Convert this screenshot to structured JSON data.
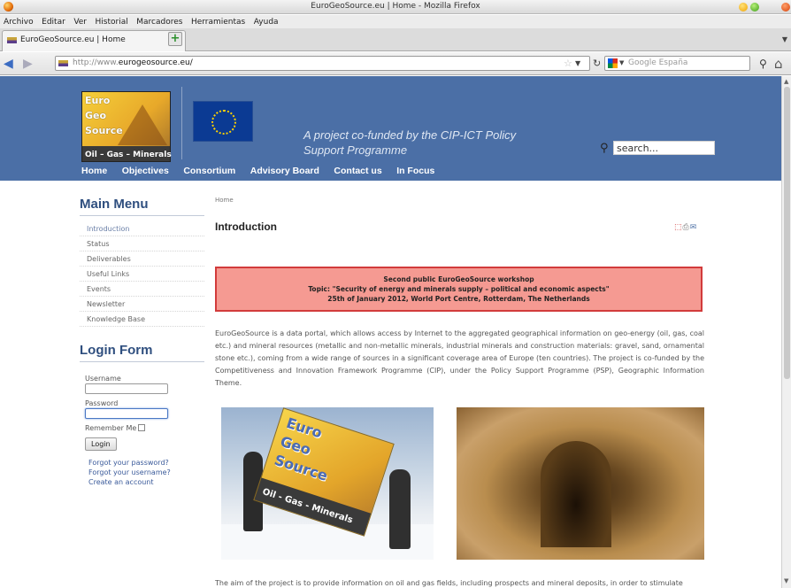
{
  "window": {
    "title": "EuroGeoSource.eu | Home - Mozilla Firefox"
  },
  "menubar": [
    "Archivo",
    "Editar",
    "Ver",
    "Historial",
    "Marcadores",
    "Herramientas",
    "Ayuda"
  ],
  "tab": {
    "title": "EuroGeoSource.eu | Home",
    "close": "×"
  },
  "navbar": {
    "url_prefix": "http://www.",
    "url_domain": "eurogeosource.eu/",
    "search_placeholder": "Google España"
  },
  "site": {
    "logo": {
      "line1": "Euro",
      "line2": "Geo",
      "line3": "Source",
      "tagline": "Oil – Gas – Minerals"
    },
    "slogan": "A project co-funded by the CIP-ICT Policy Support Programme",
    "search_value": "search...",
    "nav": [
      "Home",
      "Objectives",
      "Consortium",
      "Advisory Board",
      "Contact us",
      "In Focus"
    ]
  },
  "sidebar": {
    "main_menu_title": "Main Menu",
    "menu_items": [
      "Introduction",
      "Status",
      "Deliverables",
      "Useful Links",
      "Events",
      "Newsletter",
      "Knowledge Base"
    ],
    "login_title": "Login Form",
    "username_label": "Username",
    "password_label": "Password",
    "remember_label": "Remember Me",
    "login_button": "Login",
    "links": [
      "Forgot your password?",
      "Forgot your username?",
      "Create an account"
    ]
  },
  "content": {
    "breadcrumb": "Home",
    "title": "Introduction",
    "notice": {
      "line1": "Second public EuroGeoSource workshop",
      "line2": "Topic: \"Security of energy and minerals supply – political and economic aspects\"",
      "line3": "25th of January 2012, World Port Centre, Rotterdam, The Netherlands"
    },
    "intro": "EuroGeoSource is a data portal, which allows access by Internet to the aggregated geographical information on geo-energy (oil, gas, coal etc.) and mineral resources (metallic and non-metallic minerals, industrial minerals and construction materials: gravel, sand, ornamental stone etc.), coming from a wide range of sources in a significant coverage area of Europe (ten countries). The project is co-funded by the Competitiveness and Innovation Framework Programme (CIP), under the Policy Support Programme (PSP), Geographic Information Theme.",
    "photo_flag": {
      "w1": "Euro",
      "w2": "Geo",
      "w3": "Source",
      "band": "Oil - Gas - Minerals"
    },
    "bottom": "The aim of the project is to provide information on oil and gas fields, including prospects and mineral deposits, in order to stimulate"
  },
  "colors": {
    "header_bg": "#4b6fa6",
    "notice_bg": "#f59a92",
    "notice_border": "#d23b3b",
    "heading": "#2f4f7f"
  }
}
